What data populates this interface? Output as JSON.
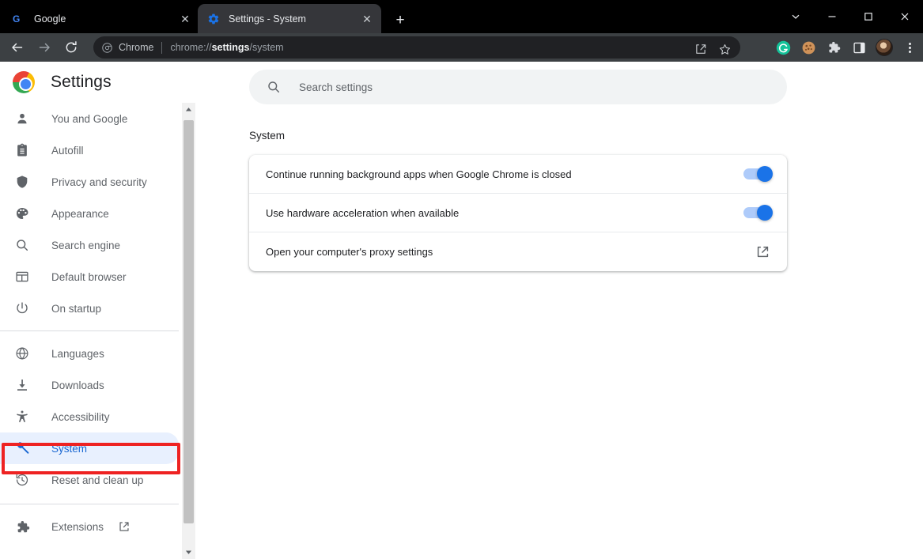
{
  "window": {
    "controls": [
      {
        "name": "tab-search",
        "icon": "chevron-down-icon",
        "label": "⌄"
      },
      {
        "name": "minimize",
        "icon": "minimize-icon",
        "label": "—"
      },
      {
        "name": "maximize",
        "icon": "maximize-icon",
        "label": "□"
      },
      {
        "name": "close",
        "icon": "close-icon",
        "label": "✕"
      }
    ]
  },
  "tabs": [
    {
      "title": "Google",
      "favicon": "google-g-icon",
      "active": false,
      "close_label": "✕"
    },
    {
      "title": "Settings - System",
      "favicon": "settings-gear-icon",
      "active": true,
      "close_label": "✕"
    }
  ],
  "newtab": {
    "label": "+",
    "name": "new-tab-button"
  },
  "toolbar": {
    "back": "←",
    "forward": "→",
    "reload": "↻",
    "omnibox": {
      "chip_label": "Chrome",
      "url_scheme": "chrome://",
      "url_bold": "settings",
      "url_rest": "/system",
      "share_icon": "share-icon",
      "bookmark_icon": "star-icon"
    },
    "actions": [
      {
        "name": "grammarly-extension-icon",
        "label": "G",
        "color": "#15c39a"
      },
      {
        "name": "cookie-extension-icon",
        "label": "",
        "color": "#c98a5a"
      },
      {
        "name": "extensions-puzzle-icon",
        "label": "",
        "color": "#dadce0"
      },
      {
        "name": "side-panel-icon",
        "label": "",
        "color": "#e8eaed"
      },
      {
        "name": "profile-avatar",
        "label": "",
        "color": "#8a6a4a"
      },
      {
        "name": "chrome-menu-icon",
        "label": "",
        "color": "#e8eaed"
      }
    ]
  },
  "settings": {
    "app_title": "Settings",
    "logo": "chrome-logo-icon",
    "search": {
      "placeholder": "Search settings",
      "value": "",
      "icon": "search-icon"
    },
    "section_label": "System",
    "sidebar": {
      "groups": [
        {
          "items": [
            {
              "label": "You and Google",
              "icon": "person-icon",
              "selected": false
            },
            {
              "label": "Autofill",
              "icon": "clipboard-icon",
              "selected": false
            },
            {
              "label": "Privacy and security",
              "icon": "shield-icon",
              "selected": false
            },
            {
              "label": "Appearance",
              "icon": "palette-icon",
              "selected": false
            },
            {
              "label": "Search engine",
              "icon": "search-icon",
              "selected": false
            },
            {
              "label": "Default browser",
              "icon": "browser-window-icon",
              "selected": false
            },
            {
              "label": "On startup",
              "icon": "power-icon",
              "selected": false
            }
          ]
        },
        {
          "items": [
            {
              "label": "Languages",
              "icon": "globe-icon",
              "selected": false
            },
            {
              "label": "Downloads",
              "icon": "download-icon",
              "selected": false
            },
            {
              "label": "Accessibility",
              "icon": "accessibility-icon",
              "selected": false
            },
            {
              "label": "System",
              "icon": "wrench-icon",
              "selected": true
            },
            {
              "label": "Reset and clean up",
              "icon": "history-restore-icon",
              "selected": false
            }
          ]
        },
        {
          "items": [
            {
              "label": "Extensions",
              "icon": "puzzle-icon",
              "selected": false,
              "external": true,
              "external_icon": "open-in-new-icon"
            }
          ]
        }
      ]
    },
    "rows": [
      {
        "label": "Continue running background apps when Google Chrome is closed",
        "control": "toggle",
        "on": true
      },
      {
        "label": "Use hardware acceleration when available",
        "control": "toggle",
        "on": true
      },
      {
        "label": "Open your computer's proxy settings",
        "control": "external-link",
        "icon": "open-in-new-icon"
      }
    ]
  },
  "annotation": {
    "color": "#ee2222",
    "target": "System"
  },
  "colors": {
    "accent": "#1a73e8",
    "selected_bg": "#e8f0fe",
    "selected_text": "#1967d2",
    "toolbar_bg": "#3c4043",
    "tabstrip_bg": "#000000",
    "active_tab_bg": "#35363a",
    "omnibox_bg": "#202124",
    "toggle_track": "#aecbfa",
    "annotation_red": "#ee2222"
  }
}
